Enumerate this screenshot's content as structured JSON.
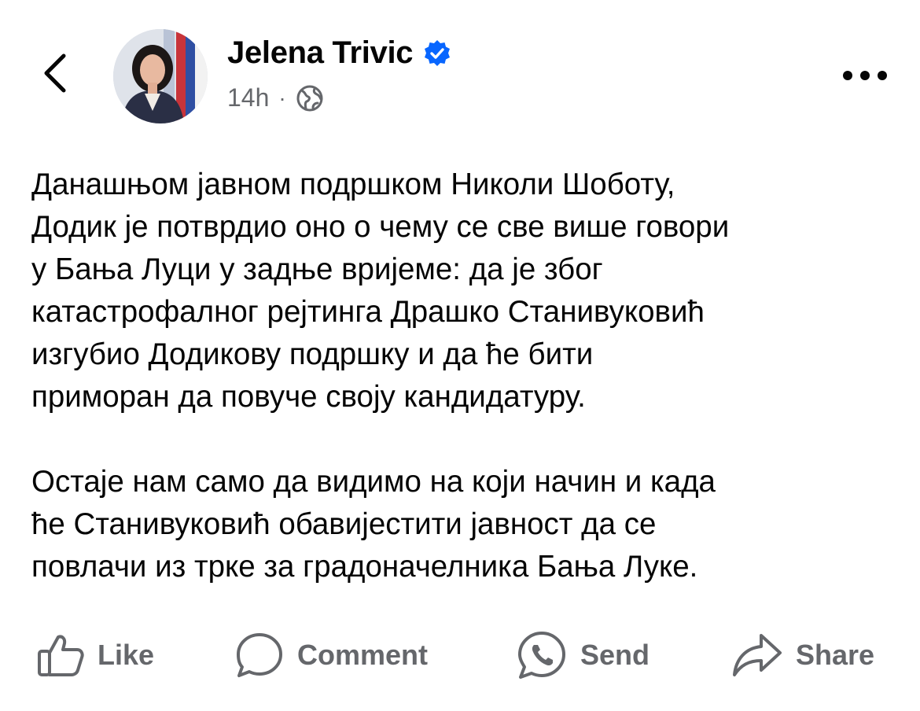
{
  "header": {
    "author_name": "Jelena Trivic",
    "time_ago": "14h",
    "separator": "·",
    "icons": {
      "back": "chevron-left-icon",
      "verified": "verified-badge-icon",
      "audience": "globe-icon",
      "more": "more-horizontal-icon"
    }
  },
  "post": {
    "paragraph_1": "Данашњом јавном подршком Николи Шоботу,\nДодик је потврдио оно о чему се све више говори\nу Бања Луци у задње вријеме: да је због\nкатастрофалног рејтинга Драшко Станивуковић\nизгубио Додикову подршку и да ће бити\nприморан да повуче своју кандидатуру.",
    "paragraph_2": "Остаје нам само да видимо на који начин и када\nће Станивуковић обавијестити јавност да се\nповлачи из трке за градоначелника Бања Луке."
  },
  "actions": {
    "like": "Like",
    "comment": "Comment",
    "send": "Send",
    "share": "Share"
  },
  "colors": {
    "text": "#050505",
    "secondary": "#65676b",
    "verified_blue": "#0866ff",
    "background": "#ffffff"
  }
}
